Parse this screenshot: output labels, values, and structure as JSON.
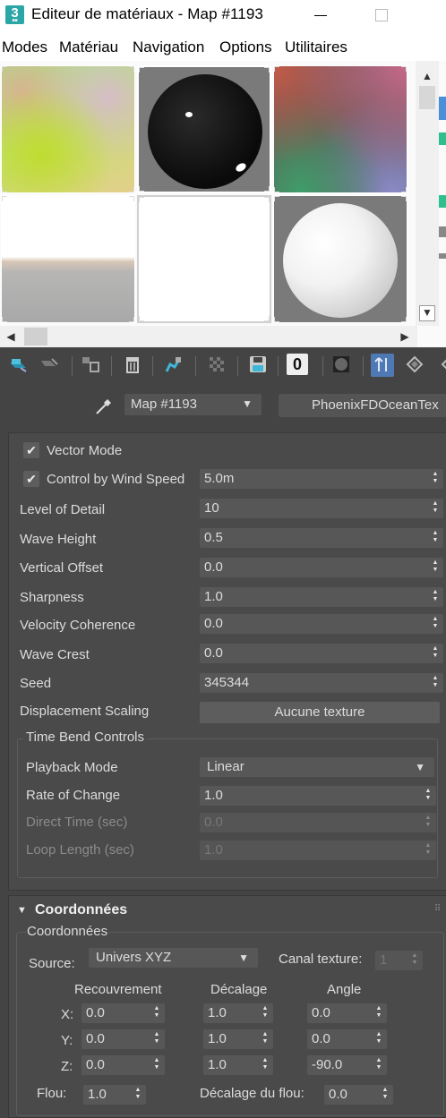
{
  "window": {
    "title": "Editeur de matériaux - Map #1193",
    "icon_text": "3"
  },
  "menu": [
    "Modes",
    "Matériau",
    "Navigation",
    "Options",
    "Utilitaires"
  ],
  "toolbar": {
    "icons": [
      "get-material-icon",
      "put-to-scene-icon",
      "assign-to-selection-icon",
      "delete-icon",
      "make-unique-icon",
      "put-to-library-icon",
      "save-icon",
      "material-id-channel-icon",
      "show-map-in-viewport-icon",
      "go-to-parent-icon",
      "go-forward-icon"
    ],
    "material_id": "0"
  },
  "map_row": {
    "map_name": "Map #1193",
    "map_type": "PhoenixFDOceanTex"
  },
  "params": {
    "vector_mode": {
      "label": "Vector Mode",
      "checked": true
    },
    "control_wind": {
      "label": "Control by Wind Speed",
      "checked": true,
      "value": "5.0m"
    },
    "rows": [
      {
        "label": "Level of Detail",
        "value": "10"
      },
      {
        "label": "Wave Height",
        "value": "0.5"
      },
      {
        "label": "Vertical Offset",
        "value": "0.0"
      },
      {
        "label": "Sharpness",
        "value": "1.0"
      },
      {
        "label": "Velocity Coherence",
        "value": "0.0"
      },
      {
        "label": "Wave Crest",
        "value": "0.0"
      },
      {
        "label": "Seed",
        "value": "345344"
      }
    ],
    "displacement": {
      "label": "Displacement Scaling",
      "button": "Aucune texture"
    },
    "time_bend": {
      "title": "Time Bend Controls",
      "playback_mode": {
        "label": "Playback Mode",
        "value": "Linear"
      },
      "rate_of_change": {
        "label": "Rate of Change",
        "value": "1.0"
      },
      "direct_time": {
        "label": "Direct Time (sec)",
        "value": "0.0"
      },
      "loop_length": {
        "label": "Loop Length (sec)",
        "value": "1.0"
      }
    }
  },
  "coords": {
    "header": "Coordonnées",
    "group_title": "Coordonnées",
    "source_label": "Source:",
    "source_value": "Univers XYZ",
    "canal_label": "Canal texture:",
    "canal_value": "1",
    "col_headers": [
      "Recouvrement",
      "Décalage",
      "Angle"
    ],
    "rows": [
      {
        "axis": "X:",
        "recouvrement": "0.0",
        "decalage": "1.0",
        "angle": "0.0"
      },
      {
        "axis": "Y:",
        "recouvrement": "0.0",
        "decalage": "1.0",
        "angle": "0.0"
      },
      {
        "axis": "Z:",
        "recouvrement": "0.0",
        "decalage": "1.0",
        "angle": "-90.0"
      }
    ],
    "flou_label": "Flou:",
    "flou_value": "1.0",
    "decalage_flou_label": "Décalage du flou:",
    "decalage_flou_value": "0.0"
  },
  "colors": {
    "accent": "#4a90d9",
    "panel": "#4a4a4a",
    "bg": "#444444"
  }
}
